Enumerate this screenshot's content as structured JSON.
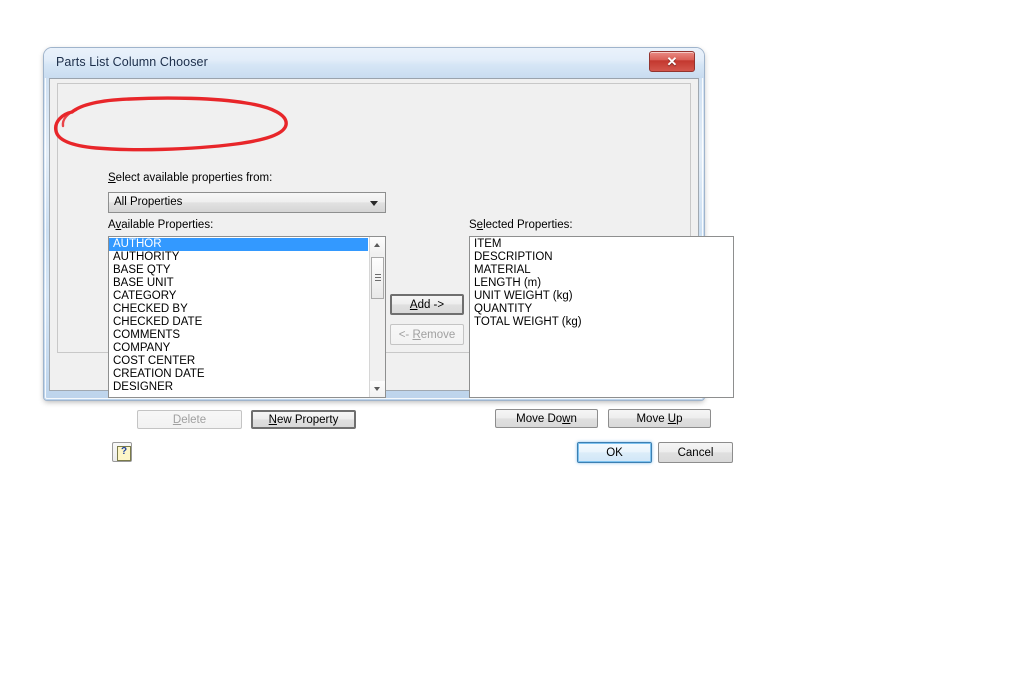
{
  "window": {
    "title": "Parts List Column Chooser",
    "close_icon": "close-x-icon",
    "close_glyph": "✕"
  },
  "labels": {
    "select_from": "Select available properties from:",
    "select_from_accel": "S",
    "available": "Available Properties:",
    "available_accel": "v",
    "selected": "Selected Properties:",
    "selected_accel": "e"
  },
  "combo": {
    "value": "All Properties",
    "arrow_icon": "chevron-down-icon",
    "options": [
      "All Properties"
    ]
  },
  "available_properties": [
    "AUTHOR",
    "AUTHORITY",
    "BASE QTY",
    "BASE UNIT",
    "CATEGORY",
    "CHECKED BY",
    "CHECKED DATE",
    "COMMENTS",
    "COMPANY",
    "COST CENTER",
    "CREATION DATE",
    "DESIGNER"
  ],
  "available_selected_index": 0,
  "selected_properties": [
    "ITEM",
    "DESCRIPTION",
    "MATERIAL",
    "LENGTH (m)",
    "UNIT WEIGHT (kg)",
    "QUANTITY",
    "TOTAL WEIGHT (kg)"
  ],
  "buttons": {
    "add": {
      "label_pre": "",
      "accel": "A",
      "label_post": "dd ->",
      "enabled": true
    },
    "remove": {
      "label_pre": "<- ",
      "accel": "R",
      "label_post": "emove",
      "enabled": false
    },
    "delete": {
      "label_pre": "",
      "accel": "D",
      "label_post": "elete",
      "enabled": false
    },
    "new_property": {
      "label_pre": "",
      "accel": "N",
      "label_post": "ew Property",
      "enabled": true
    },
    "move_down": {
      "label_pre": "Move Do",
      "accel": "w",
      "label_post": "n",
      "enabled": true
    },
    "move_up": {
      "label_pre": "Move ",
      "accel": "U",
      "label_post": "p",
      "enabled": true
    },
    "ok": {
      "label": "OK",
      "enabled": true,
      "is_default": true
    },
    "cancel": {
      "label": "Cancel",
      "enabled": true
    },
    "help": {
      "icon": "help-question-icon",
      "glyph": "?"
    }
  },
  "scrollbar": {
    "up_icon": "scroll-up-arrow-icon",
    "down_icon": "scroll-down-arrow-icon"
  },
  "annotation": {
    "type": "hand-drawn-ellipse",
    "color": "#e8262a",
    "target": "combo"
  },
  "colors": {
    "selection_blue": "#3399ff",
    "annotation_red": "#e8262a",
    "title_text": "#1c2e4a",
    "dialog_bg": "#f0f0f0",
    "close_red": "#c3382f",
    "default_button_border": "#3c7fb1"
  }
}
